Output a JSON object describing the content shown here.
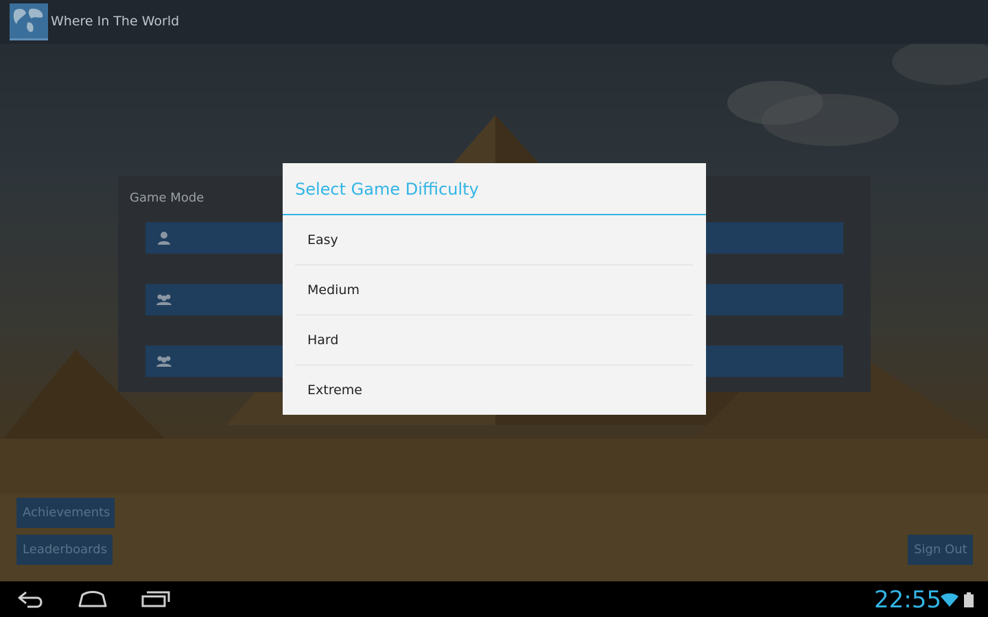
{
  "app": {
    "title": "Where In The World"
  },
  "panel": {
    "title": "Game Mode",
    "modes": [
      {
        "icon": "single-player-icon"
      },
      {
        "icon": "multiplayer-icon"
      },
      {
        "icon": "multiplayer-icon"
      }
    ]
  },
  "dialog": {
    "title": "Select Game Difficulty",
    "options": [
      "Easy",
      "Medium",
      "Hard",
      "Extreme"
    ]
  },
  "buttons": {
    "achievements": "Achievements",
    "leaderboards": "Leaderboards",
    "sign_out": "Sign Out"
  },
  "status": {
    "time": "22:55"
  },
  "colors": {
    "accent": "#33b5e5",
    "button": "#1f3a55",
    "dialog_bg": "#f3f3f3"
  }
}
